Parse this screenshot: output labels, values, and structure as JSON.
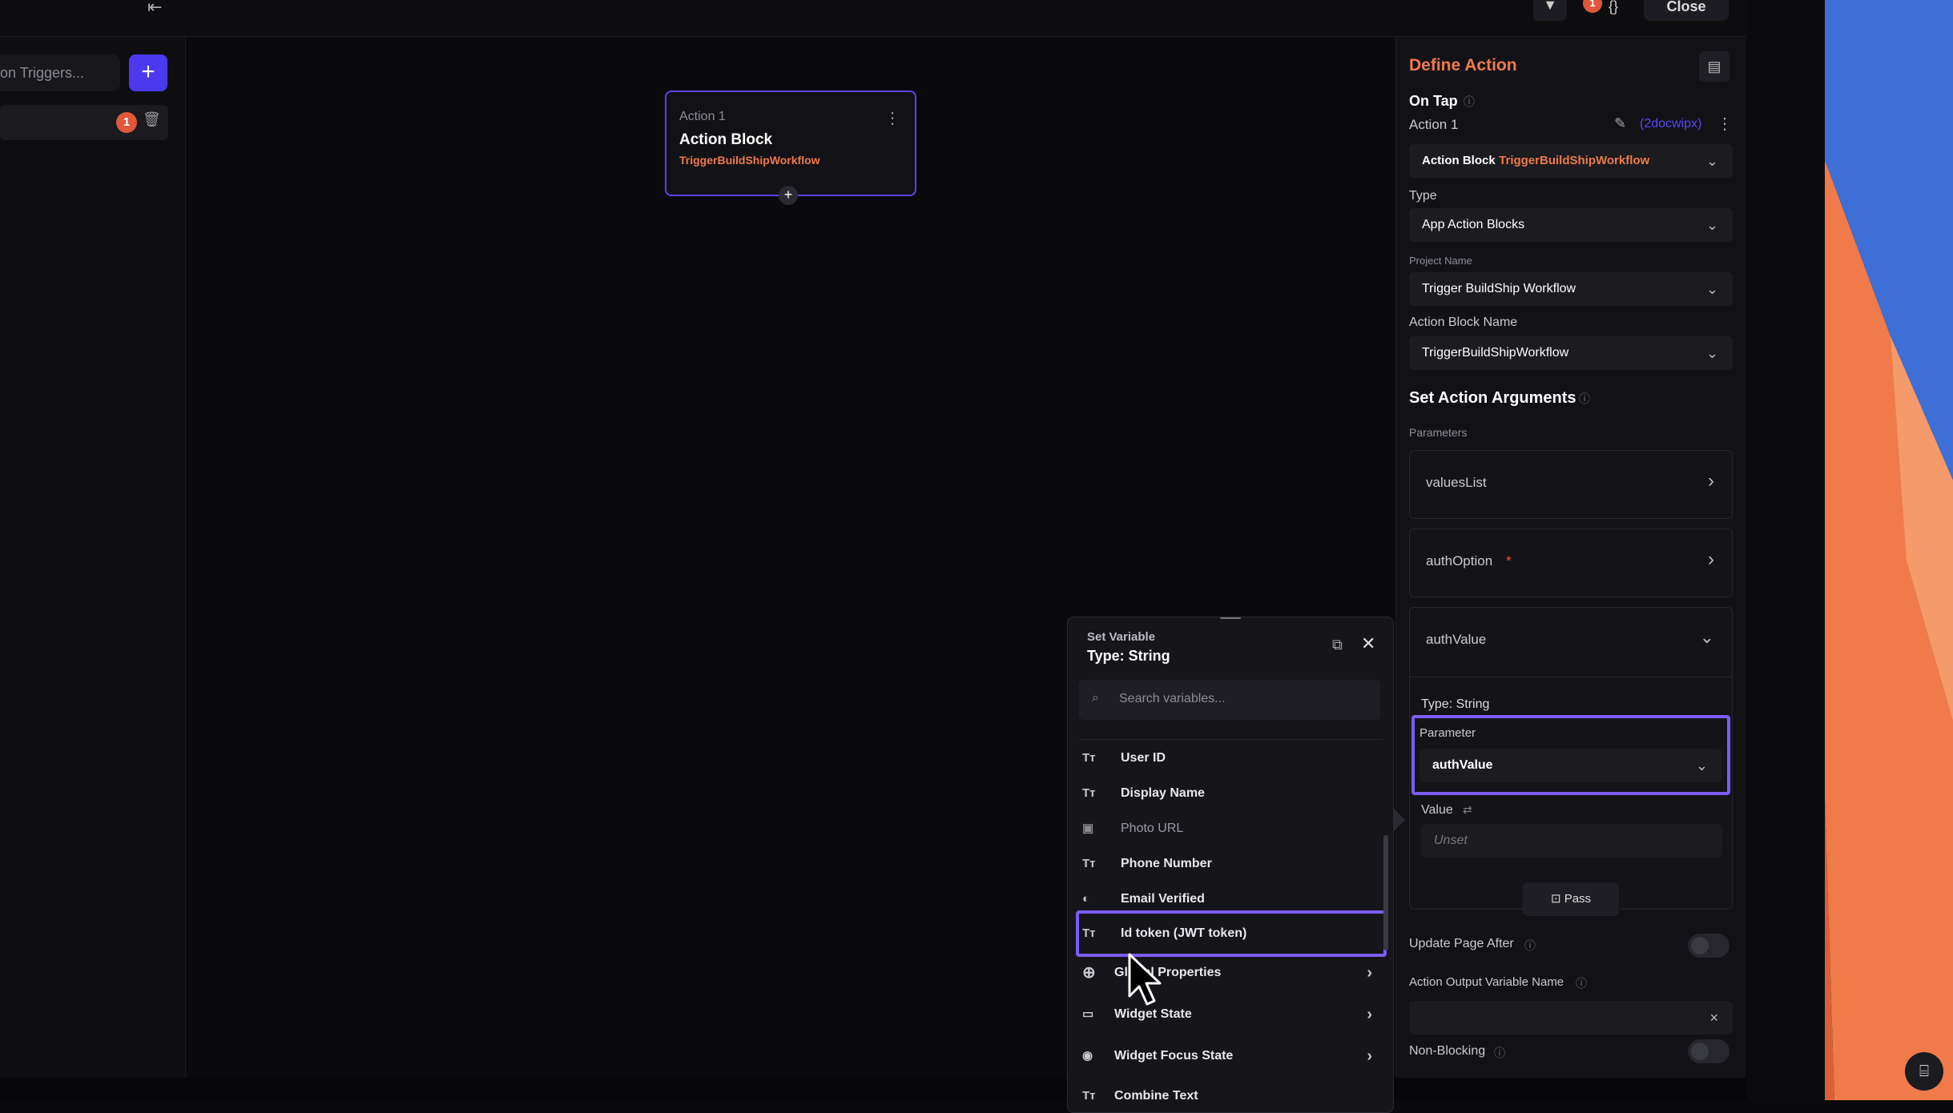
{
  "topbar": {
    "close_label": "Close",
    "badge_count": "1"
  },
  "left_panel": {
    "search_placeholder": "on Triggers...",
    "add_label": "+",
    "trigger_badge": "1"
  },
  "canvas": {
    "node": {
      "label": "Action 1",
      "title": "Action Block",
      "workflow": "TriggerBuildShipWorkflow",
      "add_label": "+"
    }
  },
  "right_panel": {
    "title": "Define Action",
    "trigger": "On Tap",
    "action_label": "Action 1",
    "action_id": "(2docwipx)",
    "action_block_prefix": "Action Block",
    "action_block_name": "TriggerBuildShipWorkflow",
    "type_label": "Type",
    "type_value": "App Action Blocks",
    "project_label": "Project Name",
    "project_value": "Trigger BuildShip Workflow",
    "block_label": "Action Block Name",
    "block_value": "TriggerBuildShipWorkflow",
    "args_title": "Set Action Arguments",
    "params_label": "Parameters",
    "params": [
      "valuesList",
      "authOption",
      "authValue"
    ],
    "required_mark": "*",
    "auth_type": "Type: String",
    "param_label": "Parameter",
    "param_value": "authValue",
    "value_label": "Value",
    "value_unset": "Unset",
    "pass_label": "Pass",
    "update_label": "Update Page After",
    "output_label": "Action Output Variable Name",
    "nonblocking_label": "Non-Blocking"
  },
  "popup": {
    "header": "Set Variable",
    "type": "Type: String",
    "search_placeholder": "Search variables...",
    "items": [
      {
        "icon": "Tт",
        "label": "User ID"
      },
      {
        "icon": "Tт",
        "label": "Display Name"
      },
      {
        "icon": "▣",
        "label": "Photo URL"
      },
      {
        "icon": "Tт",
        "label": "Phone Number"
      },
      {
        "icon": "◐",
        "label": "Email Verified"
      },
      {
        "icon": "Tт",
        "label": "Id token (JWT token)"
      }
    ],
    "groups": [
      {
        "label": "Global Properties"
      },
      {
        "label": "Widget State"
      },
      {
        "label": "Widget Focus State"
      },
      {
        "label": "Combine Text"
      }
    ]
  },
  "colors": {
    "accent": "#4b39ef",
    "highlight": "#7c5cf7",
    "orange": "#f07a4a"
  }
}
